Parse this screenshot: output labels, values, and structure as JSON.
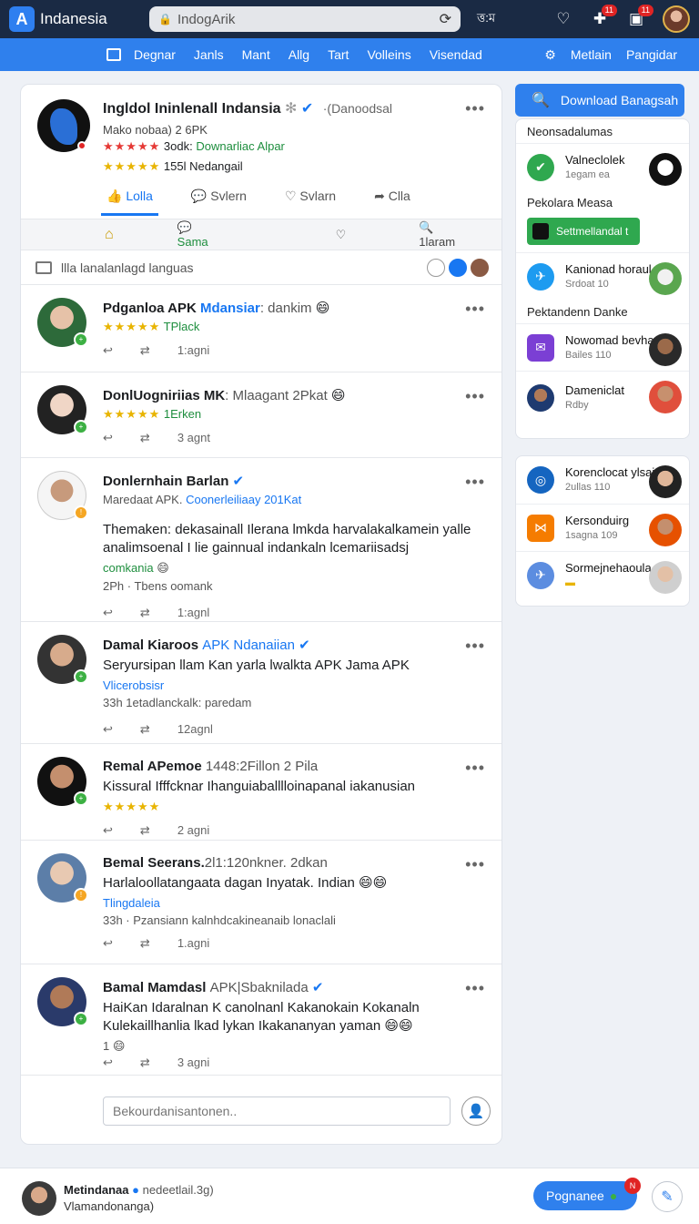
{
  "topbar": {
    "brand": "Indanesia",
    "url": "IndogArik",
    "time": "ত্ত:ম",
    "notif_badge_1": "11",
    "notif_badge_2": "11"
  },
  "nav": {
    "items": [
      "Degnar",
      "Janls",
      "Mant",
      "Allg",
      "Tart",
      "Volleins",
      "Visendad"
    ],
    "settings_label": "Metlain",
    "right_label": "Pangidar"
  },
  "profile": {
    "name": "Ingldol Ininlenall Indansia",
    "handle": "·(Danoodsal",
    "line1": "Mako nobaa) 2 6PK",
    "line2_stars": "★★★★★",
    "line2_text": "3odk:",
    "line2_green": "Downarliac Alpar",
    "line3_stars": "★★★★★",
    "line3_text": "155l Nedangail",
    "tabs": [
      "Lolla",
      "Svlern",
      "Svlarn",
      "Clla"
    ]
  },
  "actionrow": {
    "home": "⌂",
    "share": "Sama",
    "search": "1laram"
  },
  "filter": {
    "text": "llla lanalanlagd languas"
  },
  "posts": [
    {
      "name": "Pdganloa APK",
      "name_blue": "Mdansiar",
      "sub": ": dankim",
      "stars": "★★★★★",
      "meta_green": "TPlack",
      "text": "",
      "time": "1:agni"
    },
    {
      "name": "DonlUogniriias MK",
      "name_blue": "",
      "sub": ": Mlaagant 2Pkat",
      "stars": "★★★★★",
      "meta_green": "1Erken",
      "text": "",
      "time": "3 agnt"
    },
    {
      "name": "Donlernhain Barlan",
      "name_blue": "",
      "sub": "",
      "stars": "",
      "meta_green": "",
      "meta": "Maredaat APK.",
      "meta_blue": "Coonerleiliaay 201Kat",
      "text": "Themaken: dekasainall Ilerana lmkda harvalakalkamein yalle analimsoenal I lie gainnual indankaln lcemariisadsj",
      "text_green": "comkania",
      "extra": "2Ph · Tbens oomank",
      "time": "1:agnl"
    },
    {
      "name": "Damal Kiaroos",
      "name_blue": "APK Ndanaiian",
      "sub": "",
      "stars": "",
      "meta_green": "",
      "text": "Seryursipan llam Kan yarla lwalkta APK Jama APK",
      "text_blue": "Vlicerobsisr",
      "extra": "33h   1etadlanckalk: paredam",
      "time": "12agnl"
    },
    {
      "name": "Remal APemoe",
      "name_blue": "",
      "sub": "1448:2Fillon 2 Pila",
      "stars": "★★★★★",
      "meta_green": "",
      "text": "Kissural Ifffcknar Ihanguiaballlloinapanal iakanusian",
      "time": "2 agni"
    },
    {
      "name": "Bemal Seerans.",
      "name_blue": "",
      "sub": "2l1:120nkner. 2dkan",
      "stars": "",
      "meta_green": "",
      "text": "Harlaloollatangaata dagan Inyatak. Indian",
      "text_blue": "Tlingdaleia",
      "extra": "33h · Pzansiann kalnhdcakineanaib lonaclali",
      "time": "1.agni"
    },
    {
      "name": "Bamal Mamdasl",
      "name_blue": "",
      "sub": "APK|Sbaknilada",
      "stars": "",
      "meta_green": "",
      "text": "HaiKan Idaralnan K canolnanl Kakanokain Kokanaln Kulekaillhanlia lkad lykan Ikakananyan yaman",
      "extra": "1",
      "time": "3 agni"
    }
  ],
  "reply": {
    "placeholder": "Bekourdanisantonen.."
  },
  "sidebar": {
    "download_label": "Download Banagsah",
    "heading1": "Neonsadalumas",
    "items1": [
      {
        "t1": "Valneclolek",
        "t2": "1egam ea"
      }
    ],
    "heading2": "Pekolara Measa",
    "green_btn": "Settmellandal t",
    "items2": [
      {
        "t1": "Kanionad horaul",
        "t2": "Srdoat 10"
      }
    ],
    "heading3": "Pektandenn Danke",
    "items3": [
      {
        "t1": "Nowomad bevha",
        "t2": "Bailes 110"
      },
      {
        "t1": "Dameniclat",
        "t2": "Rdby"
      }
    ],
    "items4": [
      {
        "t1": "Korenclocat ylsai",
        "t2": "2ullas 110"
      },
      {
        "t1": "Kersonduirg",
        "t2": "1sagna 109"
      },
      {
        "t1": "Sormejnehaoula",
        "t2": ""
      }
    ]
  },
  "footer": {
    "name": "Metindanaa",
    "name_sub": "nedeetlail.3g)",
    "sub": "Vlamandonanga)",
    "button": "Pognanee",
    "btn_badge": "N"
  }
}
